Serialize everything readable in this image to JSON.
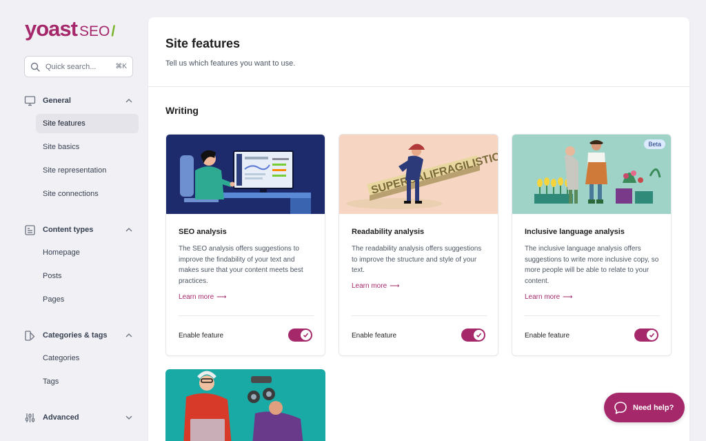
{
  "brand": {
    "name": "yoast",
    "product": "SEO",
    "slash": "/"
  },
  "search": {
    "placeholder": "Quick search...",
    "shortcut": "⌘K"
  },
  "sidebar": {
    "groups": [
      {
        "label": "General",
        "icon": "monitor-icon",
        "expanded": true,
        "items": [
          "Site features",
          "Site basics",
          "Site representation",
          "Site connections"
        ],
        "active_item": "Site features"
      },
      {
        "label": "Content types",
        "icon": "document-icon",
        "expanded": true,
        "items": [
          "Homepage",
          "Posts",
          "Pages"
        ]
      },
      {
        "label": "Categories & tags",
        "icon": "tags-icon",
        "expanded": true,
        "items": [
          "Categories",
          "Tags"
        ]
      },
      {
        "label": "Advanced",
        "icon": "sliders-icon",
        "expanded": false,
        "items": []
      }
    ]
  },
  "main": {
    "title": "Site features",
    "subtitle": "Tell us which features you want to use.",
    "section_title": "Writing",
    "cards": [
      {
        "title": "SEO analysis",
        "description": "The SEO analysis offers suggestions to improve the findability of your text and makes sure that your content meets best practices.",
        "link": "Learn more",
        "footer": "Enable feature",
        "enabled": true
      },
      {
        "title": "Readability analysis",
        "description": "The readability analysis offers suggestions to improve the structure and style of your text.",
        "link": "Learn more",
        "footer": "Enable feature",
        "enabled": true
      },
      {
        "title": "Inclusive language analysis",
        "description": "The inclusive language analysis offers suggestions to write more inclusive copy, so more people will be able to relate to your content.",
        "link": "Learn more",
        "footer": "Enable feature",
        "enabled": true,
        "badge": "Beta"
      }
    ],
    "illustration_text": "SUPERCALIFRAGILISTIC"
  },
  "help": {
    "label": "Need help?"
  },
  "colors": {
    "accent": "#a4286a",
    "accent_green": "#77b227",
    "bg": "#f0f0f5"
  }
}
